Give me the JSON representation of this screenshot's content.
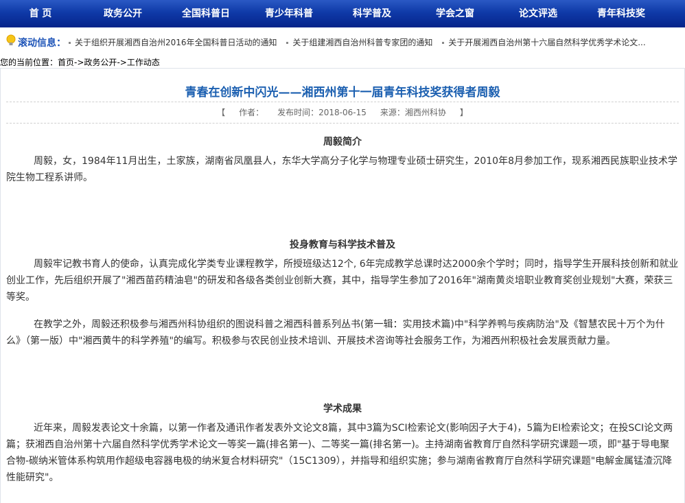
{
  "nav": {
    "items": [
      "首 页",
      "政务公开",
      "全国科普日",
      "青少年科普",
      "科学普及",
      "学会之窗",
      "论文评选",
      "青年科技奖"
    ]
  },
  "ticker": {
    "label": "滚动信息：",
    "items": [
      "关于组织开展湘西自治州2016年全国科普日活动的通知",
      "关于组建湘西自治州科普专家团的通知",
      "关于开展湘西自治州第十六届自然科学优秀学术论文..."
    ]
  },
  "breadcrumb": {
    "prefix": "您的当前位置：",
    "home": "首页",
    "sep1": "->",
    "level1": "政务公开",
    "sep2": "->",
    "level2": "工作动态"
  },
  "article": {
    "title": "青春在创新中闪光——湘西州第十一届青年科技奖获得者周毅",
    "meta": {
      "open": "【",
      "author_label": "作者：",
      "date_label": "发布时间：2018-06-15",
      "source_label": "来源：湘西州科协",
      "close": "】"
    },
    "sections": [
      {
        "heading": "周毅简介",
        "paragraphs": [
          "周毅，女，1984年11月出生，土家族，湖南省凤凰县人，东华大学高分子化学与物理专业硕士研究生，2010年8月参加工作，现系湘西民族职业技术学院生物工程系讲师。"
        ]
      },
      {
        "heading": "投身教育与科学技术普及",
        "paragraphs": [
          "周毅牢记教书育人的使命，认真完成化学类专业课程教学，所授班级达12个, 6年完成教学总课时达2000余个学时；同时，指导学生开展科技创新和就业创业工作，先后组织开展了\"湘西苗药精油皂\"的研发和各级各类创业创新大赛，其中，指导学生参加了2016年\"湖南黄炎培职业教育奖创业规划\"大赛，荣获三等奖。",
          "在教学之外，周毅还积极参与湘西州科协组织的图说科普之湘西科普系列丛书(第一辑：实用技术篇)中\"科学养鸭与疾病防治\"及《智慧农民十万个为什么》（第一版）中\"湘西黄牛的科学养殖\"的编写。积极参与农民创业技术培训、开展技术咨询等社会服务工作，为湘西州积极社会发展贡献力量。"
        ]
      },
      {
        "heading": "学术成果",
        "paragraphs": [
          "近年来，周毅发表论文十余篇，以第一作者及通讯作者发表外文论文8篇，其中3篇为SCI检索论文(影响因子大于4)，5篇为EI检索论文；在投SCI论文两篇；获湘西自治州第十六届自然科学优秀学术论文一等奖一篇(排名第一)、二等奖一篇(排名第一)。主持湖南省教育厅自然科学研究课题一项，即\"基于导电聚合物-碳纳米管体系构筑用作超级电容器电极的纳米复合材料研究\"（15C1309），并指导和组织实施；参与湖南省教育厅自然科学研究课题\"电解金属锰渣沉降性能研究\"。"
        ]
      }
    ]
  },
  "colors": {
    "nav_bg": "#0f3aa8",
    "title": "#1b5fb0",
    "ticker_label": "#1f55b8"
  }
}
